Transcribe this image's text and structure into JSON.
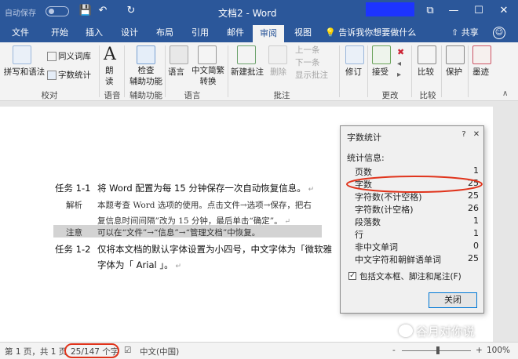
{
  "titlebar": {
    "autosave_label": "自动保存",
    "autosave_state": "关",
    "title": "文档2 - Word",
    "qat": {
      "save": "💾",
      "undo": "↶",
      "redo": "↻"
    },
    "window": {
      "ribbon_display": "⧉",
      "minimize": "—",
      "maximize": "☐",
      "close": "✕"
    }
  },
  "tabs": [
    "文件",
    "开始",
    "插入",
    "设计",
    "布局",
    "引用",
    "邮件",
    "审阅",
    "视图"
  ],
  "active_tab": "审阅",
  "tell_me": "告诉我你想要做什么",
  "share": "共享",
  "ribbon": {
    "proofing": {
      "spelling": "拼写和语法",
      "thesaurus": "同义词库",
      "word_count": "字数统计",
      "group": "校对"
    },
    "speech": {
      "read_aloud_1": "朗",
      "read_aloud_2": "读",
      "group": "语音"
    },
    "accessibility": {
      "check_1": "检查",
      "check_2": "辅助功能",
      "group": "辅助功能"
    },
    "language": {
      "language": "语言",
      "convert_1": "中文简繁",
      "convert_2": "转换",
      "group": "语言"
    },
    "comments": {
      "new": "新建批注",
      "delete": "删除",
      "previous": "上一条",
      "next": "下一条",
      "show": "显示批注",
      "group": "批注"
    },
    "tracking": {
      "track": "修订",
      "group": ""
    },
    "changes": {
      "accept": "接受",
      "group": "更改"
    },
    "compare": {
      "compare": "比较",
      "group": "比较"
    },
    "protect": {
      "protect": "保护",
      "ink": "墨迹"
    }
  },
  "document": {
    "task1_label": "任务 1-1",
    "task1_text": "将 Word 配置为每 15 分钟保存一次自动恢复信息。",
    "analysis_label": "解析",
    "analysis_line1": "本题考查 Word 选项的使用。点击文件→选项→保存，把右",
    "analysis_line2": "复信息时间间隔”改为 15 分钟，最后单击“确定”。",
    "note_label": "注意",
    "note_text": "可以在“文件”→“信息”→“管理文档”中恢复。",
    "task2_label": "任务 1-2",
    "task2_line1": "仅将本文档的默认字体设置为小四号，中文字体为「微软雅",
    "task2_line2": "字体为「 Arial 」。"
  },
  "dialog": {
    "title": "字数统计",
    "help": "?",
    "close_x": "✕",
    "stats_label": "统计信息:",
    "rows": [
      {
        "label": "页数",
        "value": "1"
      },
      {
        "label": "字数",
        "value": "25"
      },
      {
        "label": "字符数(不计空格)",
        "value": "25"
      },
      {
        "label": "字符数(计空格)",
        "value": "26"
      },
      {
        "label": "段落数",
        "value": "1"
      },
      {
        "label": "行",
        "value": "1"
      },
      {
        "label": "非中文单词",
        "value": "0"
      },
      {
        "label": "中文字符和朝鲜语单词",
        "value": "25"
      }
    ],
    "checkbox_label": "包括文本框、脚注和尾注(F)",
    "checkbox_checked": true,
    "close_button": "关闭"
  },
  "statusbar": {
    "page": "第 1 页，共 1 页",
    "words": "25/147 个字",
    "language": "中文(中国)",
    "zoom": "100%",
    "zoom_minus": "-",
    "zoom_plus": "+"
  },
  "watermark": "谷月对你说",
  "colors": {
    "word_blue": "#2b579a",
    "highlight_red": "#e0341c"
  }
}
